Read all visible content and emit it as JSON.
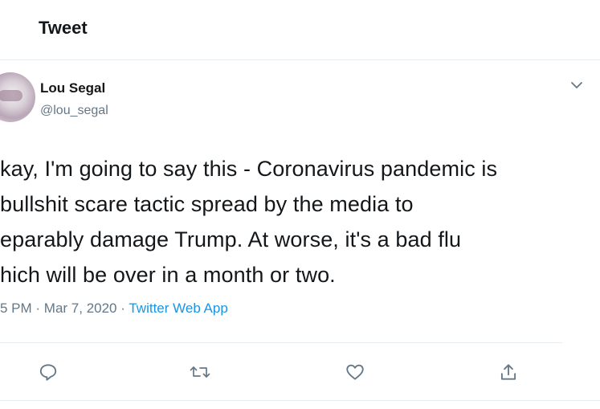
{
  "header": {
    "title": "Tweet"
  },
  "author": {
    "name": "Lou Segal",
    "handle": "@lou_segal"
  },
  "tweet": {
    "lines": [
      "kay, I'm going to say this - Coronavirus pandemic is",
      "bullshit scare tactic spread by the media to",
      "eparably damage Trump. At worse, it's a bad flu",
      "hich will be over in a month or two."
    ]
  },
  "meta": {
    "time": "5 PM",
    "separator": " · ",
    "date": "Mar 7, 2020",
    "source": "Twitter Web App"
  },
  "actions": {
    "reply_icon": "reply-icon",
    "retweet_icon": "retweet-icon",
    "like_icon": "like-icon",
    "share_icon": "share-icon"
  },
  "colors": {
    "text": "#14171a",
    "muted": "#657786",
    "link": "#1b95e0",
    "divider": "#e6ecf0"
  }
}
